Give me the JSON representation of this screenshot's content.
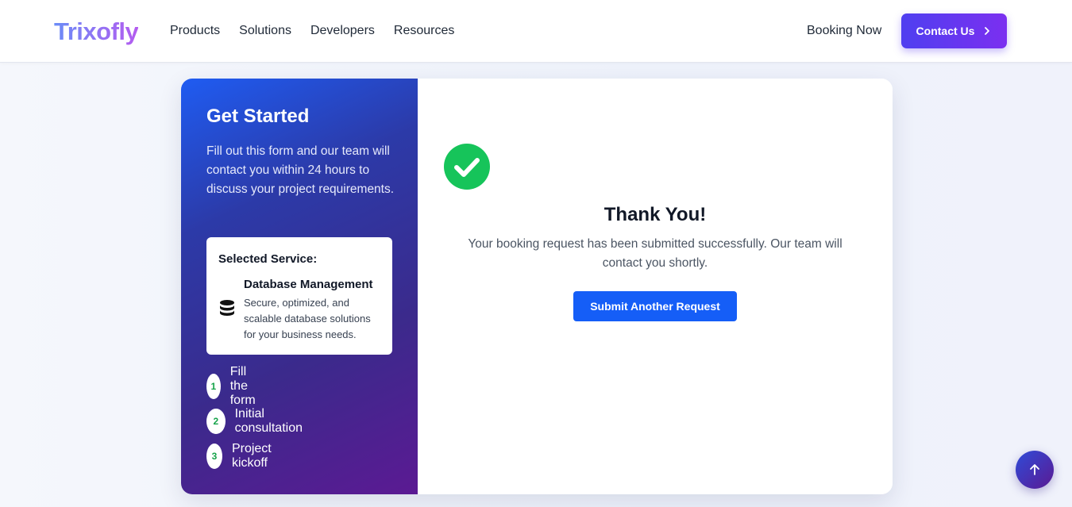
{
  "header": {
    "logo": "Trixofly",
    "nav": [
      "Products",
      "Solutions",
      "Developers",
      "Resources"
    ],
    "booking_link": "Booking Now",
    "contact_button": "Contact Us"
  },
  "left_panel": {
    "title": "Get Started",
    "description": "Fill out this form and our team will contact you within 24 hours to discuss your project requirements.",
    "selected_service": {
      "label": "Selected Service:",
      "name": "Database Management",
      "description": "Secure, optimized, and scalable database solutions for your business needs.",
      "icon": "database-icon"
    },
    "steps": [
      {
        "number": "1",
        "label": "Fill the form"
      },
      {
        "number": "2",
        "label": "Initial consultation"
      },
      {
        "number": "3",
        "label": "Project kickoff"
      }
    ]
  },
  "right_panel": {
    "icon": "check-circle-icon",
    "title": "Thank You!",
    "message": "Your booking request has been submitted successfully. Our team will contact you shortly.",
    "button": "Submit Another Request"
  },
  "colors": {
    "primary": "#155ef7",
    "accent_purple": "#7b2ff0",
    "success": "#16c45a"
  }
}
